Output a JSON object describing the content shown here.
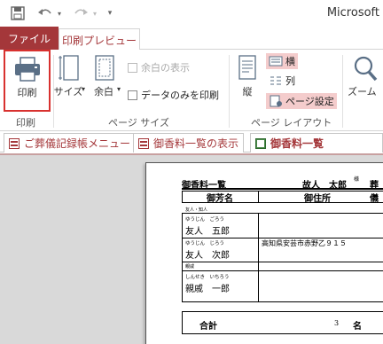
{
  "app": {
    "title": "Microsoft"
  },
  "qat": {
    "icons": [
      "save-icon",
      "undo-icon",
      "redo-icon",
      "customize-icon"
    ]
  },
  "tabs": {
    "file": "ファイル",
    "print_preview": "印刷プレビュー"
  },
  "ribbon": {
    "print": {
      "label": "印刷",
      "group": "印刷"
    },
    "page_size": {
      "size_label": "サイズ",
      "margin_label": "余白",
      "show_margins": "余白の表示",
      "data_only": "データのみを印刷",
      "group": "ページ サイズ"
    },
    "layout": {
      "portrait": "縦",
      "landscape": "横",
      "columns": "列",
      "page_setup": "ページ設定",
      "group": "ページ レイアウト"
    },
    "zoom": {
      "label": "ズーム"
    }
  },
  "object_tabs": [
    {
      "label": "ご葬儀記録帳メニュー"
    },
    {
      "label": "御香料一覧の表示"
    },
    {
      "label": "御香料一覧"
    }
  ],
  "report": {
    "title": "御香料一覧",
    "deceased": "故人　太郎",
    "honorific": "様",
    "trailing": "葬儀",
    "col_name": "御芳名",
    "col_address": "御住所",
    "groups": [
      {
        "group_label": "友人・知人",
        "entries": [
          {
            "kana": "ゆうじん　ごろう",
            "name": "友人　五郎",
            "address": ""
          },
          {
            "kana": "ゆうじん　じろう",
            "name": "友人　次郎",
            "address": "高知県安芸市赤野乙９１５"
          }
        ]
      },
      {
        "group_label": "親戚",
        "entries": [
          {
            "kana": "しんせき　いちろう",
            "name": "親戚　一郎",
            "address": ""
          }
        ]
      }
    ],
    "total_label": "合計",
    "total_count": "3",
    "total_unit": "名"
  }
}
